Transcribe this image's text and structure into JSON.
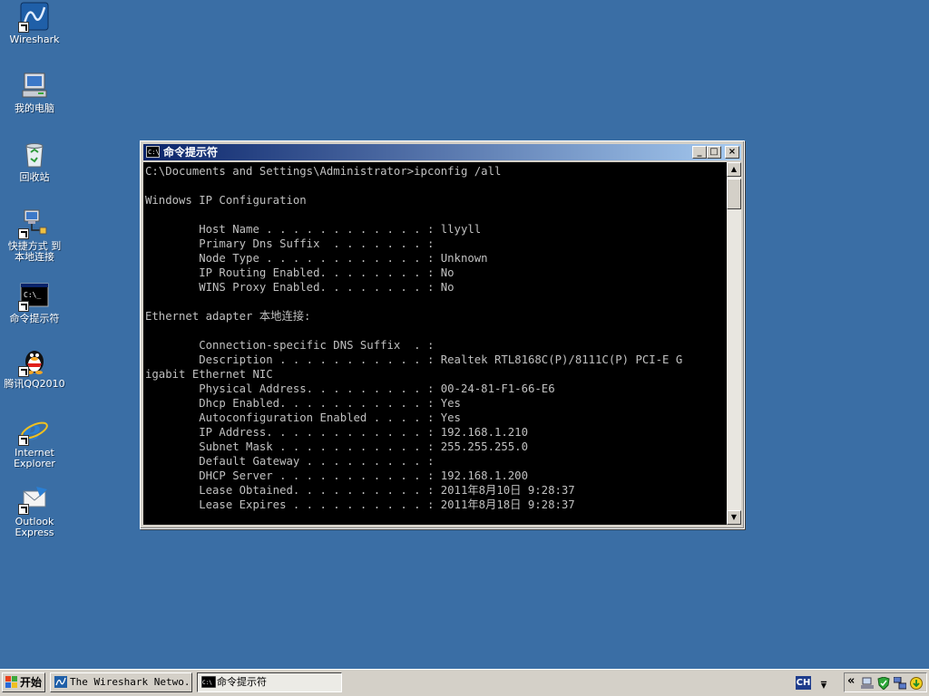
{
  "desktop": {
    "icons": [
      {
        "label": "Wireshark",
        "icon": "wireshark-icon"
      },
      {
        "label": "我的电脑",
        "icon": "my-computer-icon"
      },
      {
        "label": "回收站",
        "icon": "recycle-bin-icon"
      },
      {
        "label": "快捷方式 到\n本地连接",
        "icon": "network-connection-icon"
      },
      {
        "label": "命令提示符",
        "icon": "command-prompt-icon"
      },
      {
        "label": "腾讯QQ2010",
        "icon": "qq-penguin-icon"
      },
      {
        "label": "Internet\nExplorer",
        "icon": "internet-explorer-icon"
      },
      {
        "label": "Outlook\nExpress",
        "icon": "outlook-express-icon"
      }
    ]
  },
  "window": {
    "title": "命令提示符",
    "icon_text": "C:\\",
    "buttons": {
      "minimize": "_",
      "maximize": "□",
      "close": "×"
    },
    "console_lines": [
      "C:\\Documents and Settings\\Administrator>ipconfig /all",
      "",
      "Windows IP Configuration",
      "",
      "        Host Name . . . . . . . . . . . . : llyyll",
      "        Primary Dns Suffix  . . . . . . . :",
      "        Node Type . . . . . . . . . . . . : Unknown",
      "        IP Routing Enabled. . . . . . . . : No",
      "        WINS Proxy Enabled. . . . . . . . : No",
      "",
      "Ethernet adapter 本地连接:",
      "",
      "        Connection-specific DNS Suffix  . :",
      "        Description . . . . . . . . . . . : Realtek RTL8168C(P)/8111C(P) PCI-E G",
      "igabit Ethernet NIC",
      "        Physical Address. . . . . . . . . : 00-24-81-F1-66-E6",
      "        Dhcp Enabled. . . . . . . . . . . : Yes",
      "        Autoconfiguration Enabled . . . . : Yes",
      "        IP Address. . . . . . . . . . . . : 192.168.1.210",
      "        Subnet Mask . . . . . . . . . . . : 255.255.255.0",
      "        Default Gateway . . . . . . . . . :",
      "        DHCP Server . . . . . . . . . . . : 192.168.1.200",
      "        Lease Obtained. . . . . . . . . . : 2011年8月10日 9:28:37",
      "        Lease Expires . . . . . . . . . . : 2011年8月18日 9:28:37"
    ]
  },
  "taskbar": {
    "start_label": "开始",
    "tasks": [
      {
        "label": "The Wireshark Netwo...",
        "icon": "wireshark-icon",
        "active": false
      },
      {
        "label": "命令提示符",
        "icon": "command-prompt-icon",
        "active": true
      }
    ],
    "language": "CH",
    "tray_chevron": "«",
    "tray_icons": [
      "network-icon",
      "shield-icon",
      "network-connections-icon",
      "update-icon"
    ]
  },
  "colors": {
    "desktop": "#3a6ea5",
    "titlebar_start": "#0a246a",
    "titlebar_end": "#a6caf0",
    "console_bg": "#000000",
    "console_fg": "#c0c0c0",
    "taskbar": "#d4d0c8"
  }
}
